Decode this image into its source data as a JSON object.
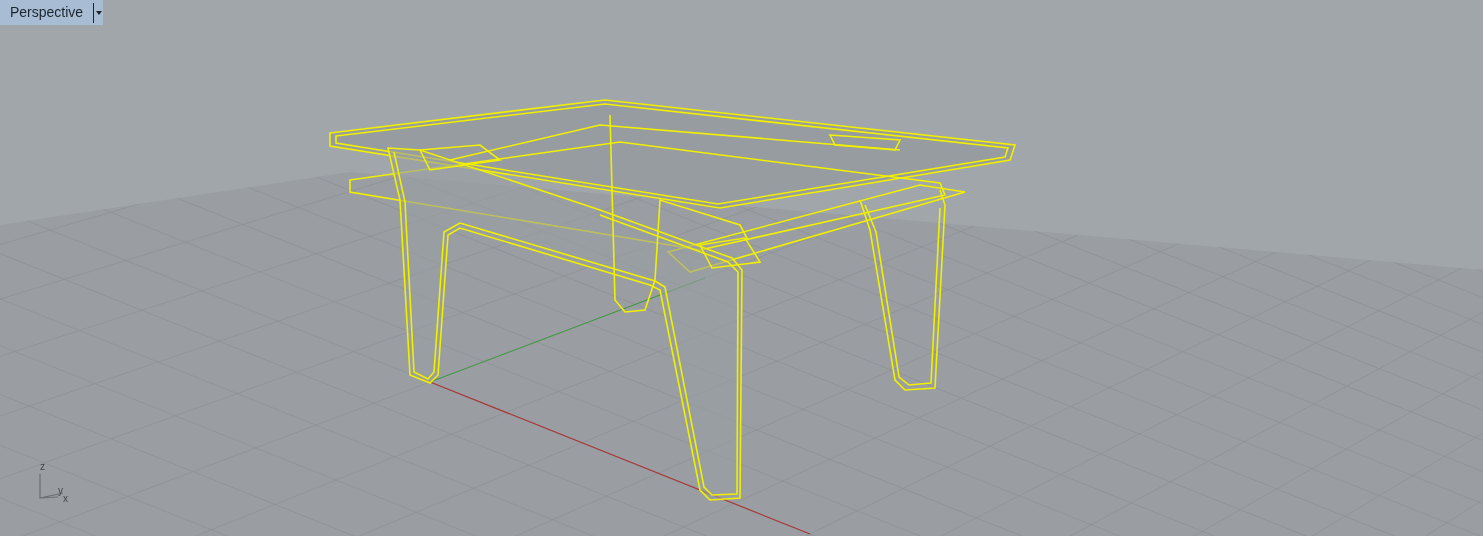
{
  "viewport": {
    "title": "Perspective",
    "axis_labels": [
      "z",
      "y",
      "x"
    ]
  }
}
